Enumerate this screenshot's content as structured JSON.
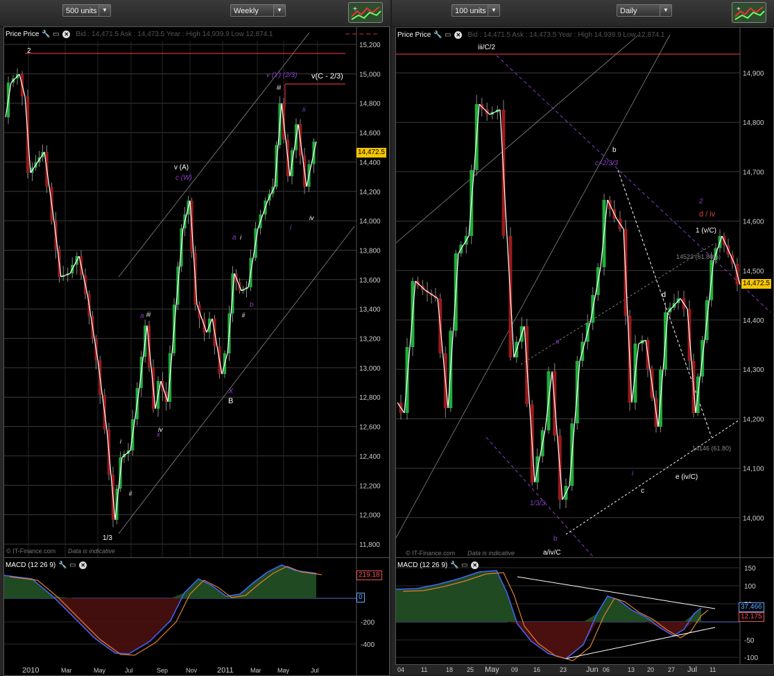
{
  "left": {
    "units_label": "500 units",
    "timeframe": "Weekly",
    "chart_title": "Price Price",
    "quote": "Bid : 14,471.5  Ask : 14,473.5  Year : High 14,939.9  Low 12,874.1",
    "watermark": "© IT-Finance.com",
    "indicative": "Data is indicative",
    "last_price": "14,472.5",
    "y_ticks": [
      "15,200",
      "15,000",
      "14,800",
      "14,600",
      "14,400",
      "14,200",
      "14,000",
      "13,800",
      "13,600",
      "13,400",
      "13,200",
      "13,000",
      "12,800",
      "12,600",
      "12,400",
      "12,200",
      "12,000",
      "11,800"
    ],
    "x_ticks": [
      "2010",
      "Mar",
      "May",
      "Jul",
      "Sep",
      "Nov",
      "2011",
      "Mar",
      "May",
      "Jul"
    ],
    "labels": {
      "w2": "2",
      "w13": "1/3",
      "a_iii": "a",
      "iii": "iii",
      "iv1": "iv",
      "ii1": "ii",
      "i1": "i",
      "x1": "x",
      "vA": "v (A)",
      "cW": "c (W)",
      "a2": "a",
      "i2": "i",
      "b2": "b",
      "ii2": "ii",
      "X": "X",
      "B": "B",
      "vY": "v (Y) (2/3)",
      "vC": "v(C - 2/3)",
      "iii2": "iii",
      "ii3": "ii",
      "i3": "i",
      "iv3": "iv"
    },
    "macd_title": "MACD (12 26 9)",
    "macd_ticks": [
      "-200",
      "-400"
    ],
    "macd_tags": {
      "top": "219.18",
      "zero": "0"
    }
  },
  "right": {
    "units_label": "100 units",
    "timeframe": "Daily",
    "chart_title": "Price Price",
    "quote": "Bid : 14,471.5  Ask : 14,473.5  Year : High 14,939.9  Low 12,874.1",
    "watermark": "© IT-Finance.com",
    "indicative": "Data is indicative",
    "last_price": "14,472.5",
    "y_ticks": [
      "14,900",
      "14,800",
      "14,700",
      "14,600",
      "14,500",
      "14,400",
      "14,300",
      "14,200",
      "14,100",
      "14,000"
    ],
    "x_ticks": [
      "04",
      "11",
      "18",
      "25",
      "May",
      "09",
      "16",
      "23",
      "Jun",
      "06",
      "13",
      "20",
      "27",
      "Jul",
      "11"
    ],
    "labels": {
      "iiiC2": "iii/C/2",
      "b": "b",
      "c233": "c=2/3/3",
      "a": "a",
      "d": "d",
      "d_iv": "d / iv",
      "two": "2",
      "w1vC": "1 (v/C)",
      "fib1": "14523 (61.80%)",
      "fib2": "14146 (61.80)",
      "c": "c",
      "i": "i",
      "e_ivC": "e (iv/C)",
      "l133": "1/3/3",
      "b2": "b",
      "aivC": "a/iv/C"
    },
    "macd_title": "MACD (12 26 9)",
    "macd_ticks": [
      "150",
      "100",
      "50",
      "-50",
      "-100"
    ],
    "macd_tags": {
      "top": "37.466",
      "bot": "12.175"
    }
  },
  "colors": {
    "bull": "#1fae3a",
    "bear": "#9a1a1a",
    "resistance": "#d0303a",
    "wave": "#8a3ec8",
    "price_tag": "#f4c400"
  },
  "icons": [
    "wrench-icon",
    "window-icon",
    "close-icon",
    "dropdown-arrow-icon",
    "logo-icon"
  ]
}
